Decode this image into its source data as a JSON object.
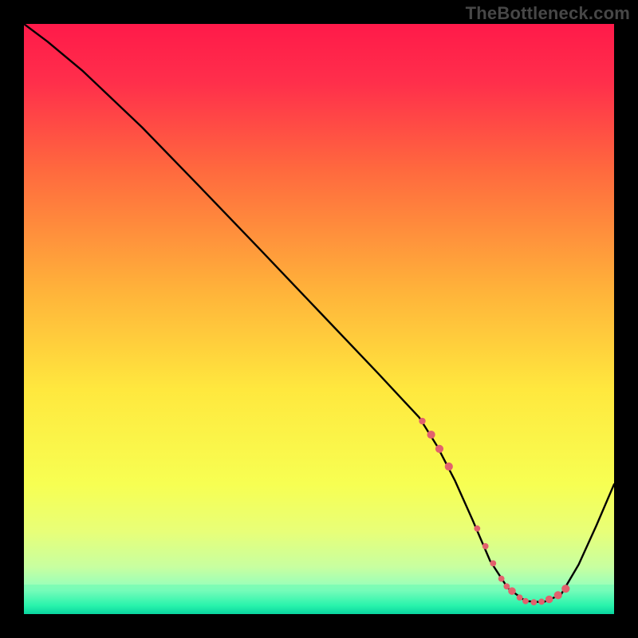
{
  "watermark": "TheBottleneck.com",
  "colors": {
    "frame_bg": "#000000",
    "line": "#000000",
    "marker_fill": "#e2616d",
    "marker_stroke": "#e2616d",
    "gradient_stops": [
      {
        "offset": 0.0,
        "color": "#ff1a4a"
      },
      {
        "offset": 0.1,
        "color": "#ff2f4b"
      },
      {
        "offset": 0.25,
        "color": "#ff6a3e"
      },
      {
        "offset": 0.45,
        "color": "#ffb23a"
      },
      {
        "offset": 0.62,
        "color": "#ffe83e"
      },
      {
        "offset": 0.78,
        "color": "#f7ff52"
      },
      {
        "offset": 0.86,
        "color": "#e8ff78"
      },
      {
        "offset": 0.92,
        "color": "#c8ffa0"
      },
      {
        "offset": 0.96,
        "color": "#8effc0"
      },
      {
        "offset": 0.985,
        "color": "#30f5b0"
      },
      {
        "offset": 1.0,
        "color": "#07cfa0"
      }
    ]
  },
  "chart_data": {
    "type": "line",
    "title": "",
    "xlabel": "",
    "ylabel": "",
    "xlim": [
      0,
      100
    ],
    "ylim": [
      0,
      100
    ],
    "grid": false,
    "legend": false,
    "series": [
      {
        "name": "curve",
        "x": [
          0,
          4,
          10,
          20,
          30,
          40,
          50,
          60,
          67,
          70,
          73,
          76,
          79,
          82,
          85,
          88,
          91,
          94,
          97,
          100
        ],
        "y": [
          100,
          97,
          92,
          82.5,
          72.2,
          61.8,
          51.3,
          40.8,
          33.3,
          28.5,
          22.7,
          16.0,
          9.0,
          4.4,
          2.2,
          2.0,
          3.3,
          8.4,
          15.0,
          22.0
        ]
      }
    ],
    "markers": {
      "x": [
        67.5,
        69.0,
        70.4,
        72.0,
        76.8,
        78.2,
        79.5,
        80.9,
        81.8,
        82.7,
        84.0,
        85.0,
        86.4,
        87.7,
        89.0,
        90.5,
        91.8
      ],
      "y": [
        32.7,
        30.4,
        28.0,
        25.0,
        14.5,
        11.5,
        8.6,
        6.0,
        4.7,
        3.9,
        2.8,
        2.2,
        2.0,
        2.1,
        2.5,
        3.2,
        4.3
      ],
      "r": [
        4.2,
        5.1,
        5.1,
        5.1,
        3.9,
        3.9,
        3.9,
        3.9,
        3.9,
        4.8,
        3.9,
        3.9,
        3.9,
        3.9,
        4.8,
        5.1,
        5.1
      ]
    }
  }
}
